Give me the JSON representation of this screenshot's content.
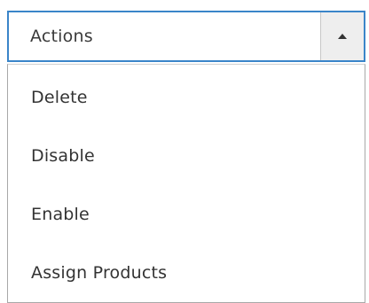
{
  "actions": {
    "label": "Actions",
    "toggle_icon": "arrow-up-icon",
    "items": [
      {
        "label": "Delete"
      },
      {
        "label": "Disable"
      },
      {
        "label": "Enable"
      },
      {
        "label": "Assign Products"
      }
    ]
  },
  "colors": {
    "focus_border": "#3a85c9",
    "toggle_bg": "#eeeeee",
    "text": "#333333"
  }
}
